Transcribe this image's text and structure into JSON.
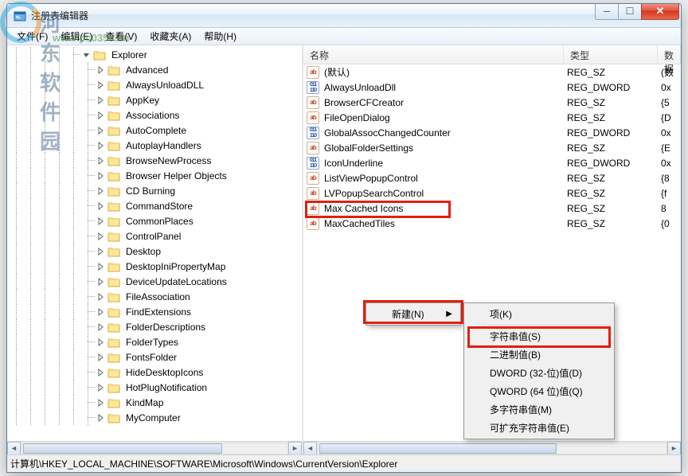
{
  "window": {
    "title": "注册表编辑器"
  },
  "watermark": {
    "name": "河东软件园",
    "url": "www.pc0359.cn"
  },
  "menu": {
    "file": "文件(F)",
    "edit": "编辑(E)",
    "view": "查看(V)",
    "favorites": "收藏夹(A)",
    "help": "帮助(H)"
  },
  "columns": {
    "name": "名称",
    "type": "类型",
    "data": "数据"
  },
  "tree": {
    "root": "Explorer",
    "nodes": [
      "Advanced",
      "AlwaysUnloadDLL",
      "AppKey",
      "Associations",
      "AutoComplete",
      "AutoplayHandlers",
      "BrowseNewProcess",
      "Browser Helper Objects",
      "CD Burning",
      "CommandStore",
      "CommonPlaces",
      "ControlPanel",
      "Desktop",
      "DesktopIniPropertyMap",
      "DeviceUpdateLocations",
      "FileAssociation",
      "FindExtensions",
      "FolderDescriptions",
      "FolderTypes",
      "FontsFolder",
      "HideDesktopIcons",
      "HotPlugNotification",
      "KindMap",
      "MyComputer"
    ]
  },
  "values": [
    {
      "icon": "ab",
      "name": "(默认)",
      "type": "REG_SZ",
      "data": "(数"
    },
    {
      "icon": "bin",
      "name": "AlwaysUnloadDll",
      "type": "REG_DWORD",
      "data": "0x"
    },
    {
      "icon": "ab",
      "name": "BrowserCFCreator",
      "type": "REG_SZ",
      "data": "{5"
    },
    {
      "icon": "ab",
      "name": "FileOpenDialog",
      "type": "REG_SZ",
      "data": "{D"
    },
    {
      "icon": "bin",
      "name": "GlobalAssocChangedCounter",
      "type": "REG_DWORD",
      "data": "0x"
    },
    {
      "icon": "ab",
      "name": "GlobalFolderSettings",
      "type": "REG_SZ",
      "data": "{E"
    },
    {
      "icon": "bin",
      "name": "IconUnderline",
      "type": "REG_DWORD",
      "data": "0x"
    },
    {
      "icon": "ab",
      "name": "ListViewPopupControl",
      "type": "REG_SZ",
      "data": "{8"
    },
    {
      "icon": "ab",
      "name": "LVPopupSearchControl",
      "type": "REG_SZ",
      "data": "{f"
    },
    {
      "icon": "ab",
      "name": "Max Cached Icons",
      "type": "REG_SZ",
      "data": "8"
    },
    {
      "icon": "ab",
      "name": "MaxCachedTiles",
      "type": "REG_SZ",
      "data": "{0"
    }
  ],
  "context": {
    "new": "新建(N)",
    "submenu": {
      "key": "项(K)",
      "string": "字符串值(S)",
      "binary": "二进制值(B)",
      "dword": "DWORD (32-位)值(D)",
      "qword": "QWORD (64 位)值(Q)",
      "multi": "多字符串值(M)",
      "expand": "可扩充字符串值(E)"
    }
  },
  "statusbar": {
    "path": "计算机\\HKEY_LOCAL_MACHINE\\SOFTWARE\\Microsoft\\Windows\\CurrentVersion\\Explorer"
  }
}
